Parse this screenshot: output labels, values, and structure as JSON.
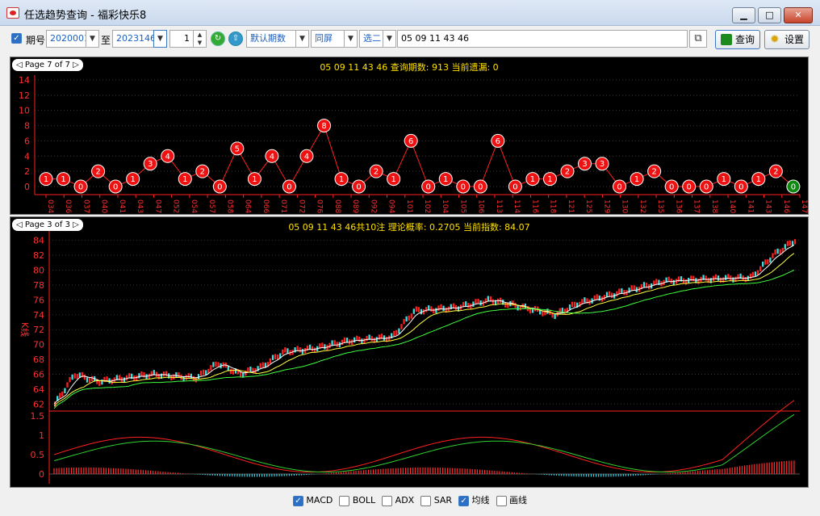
{
  "window": {
    "title": "任选趋势查询 - 福彩快乐8",
    "minimize_icon": "minimize-icon",
    "maximize_icon": "maximize-icon",
    "close_icon": "close-icon"
  },
  "toolbar": {
    "period_label": "期号",
    "from": "2020001",
    "to_label": "至",
    "to": "2023146",
    "count": "1",
    "mode": "默认期数",
    "screen": "同屏",
    "select": "选二",
    "numbers": "05 09 11 43 46",
    "query_label": "查询",
    "settings_label": "设置"
  },
  "top_chart": {
    "page_label": "◁ Page 7 of 7 ▷",
    "title": "05 09 11 43 46 查询期数: 913 当前遗漏: 0",
    "y_ticks": [
      14,
      12,
      10,
      8,
      6,
      4,
      2,
      0
    ]
  },
  "chart_data": [
    {
      "type": "line",
      "title": "05 09 11 43 46 查询期数: 913 当前遗漏: 0",
      "x": [
        "034",
        "036",
        "037",
        "040",
        "041",
        "043",
        "047",
        "052",
        "054",
        "057",
        "058",
        "064",
        "066",
        "071",
        "072",
        "076",
        "088",
        "089",
        "092",
        "094",
        "101",
        "102",
        "104",
        "105",
        "106",
        "113",
        "114",
        "116",
        "118",
        "121",
        "125",
        "129",
        "130",
        "132",
        "135",
        "136",
        "137",
        "138",
        "140",
        "141",
        "143",
        "146",
        "147"
      ],
      "values": [
        1,
        1,
        0,
        2,
        0,
        1,
        3,
        4,
        1,
        2,
        0,
        5,
        1,
        4,
        0,
        4,
        8,
        1,
        0,
        2,
        1,
        6,
        0,
        1,
        0,
        0,
        6,
        0,
        1,
        1,
        2,
        3,
        3,
        0,
        1,
        2,
        0,
        0,
        0,
        1,
        0,
        1,
        2,
        0
      ],
      "ylim": [
        0,
        14
      ],
      "colors": {
        "line": "#ff2020",
        "marker": "#ee1111",
        "current": "#118811"
      }
    },
    {
      "type": "line",
      "title": "05 09 11 43 46共10注 理论概率: 0.2705 当前指数: 84.07",
      "ylabel": "K线",
      "y_ticks": [
        84,
        82,
        80,
        78,
        76,
        74,
        72,
        70,
        68,
        66,
        64,
        62
      ],
      "ylim": [
        61.5,
        84.5
      ],
      "macd_label": "MACD",
      "macd_ticks": [
        1.5,
        1,
        0.5,
        0
      ],
      "page_label": "◁ Page 3 of 3 ▷"
    }
  ],
  "legend": [
    {
      "label": "MACD",
      "checked": true
    },
    {
      "label": "BOLL",
      "checked": false
    },
    {
      "label": "ADX",
      "checked": false
    },
    {
      "label": "SAR",
      "checked": false
    },
    {
      "label": "均线",
      "checked": true
    },
    {
      "label": "画线",
      "checked": false
    }
  ]
}
